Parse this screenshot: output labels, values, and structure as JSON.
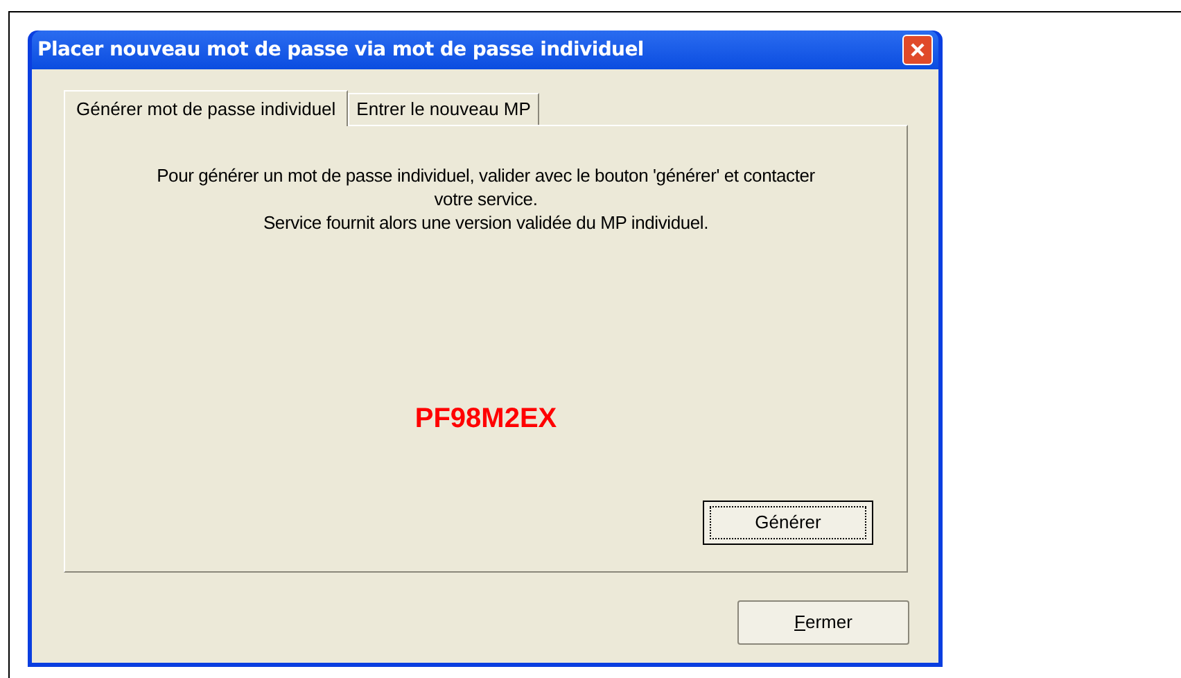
{
  "window": {
    "title": "Placer nouveau mot de passe via mot de passe individuel"
  },
  "tabs": [
    {
      "label": "Générer mot de passe individuel",
      "selected": true
    },
    {
      "label": "Entrer le nouveau MP",
      "selected": false
    }
  ],
  "instructions": [
    "Pour générer un mot de passe individuel, valider avec le bouton 'générer' et contacter votre service.",
    "Service fournit alors une version validée du MP individuel."
  ],
  "password": "PF98M2EX",
  "generate_button": {
    "label": "Générer",
    "focused": true
  },
  "close_button": {
    "label_parts": [
      {
        "text": "F",
        "underlined": true
      },
      {
        "text": "ermer",
        "underlined": false
      }
    ]
  }
}
